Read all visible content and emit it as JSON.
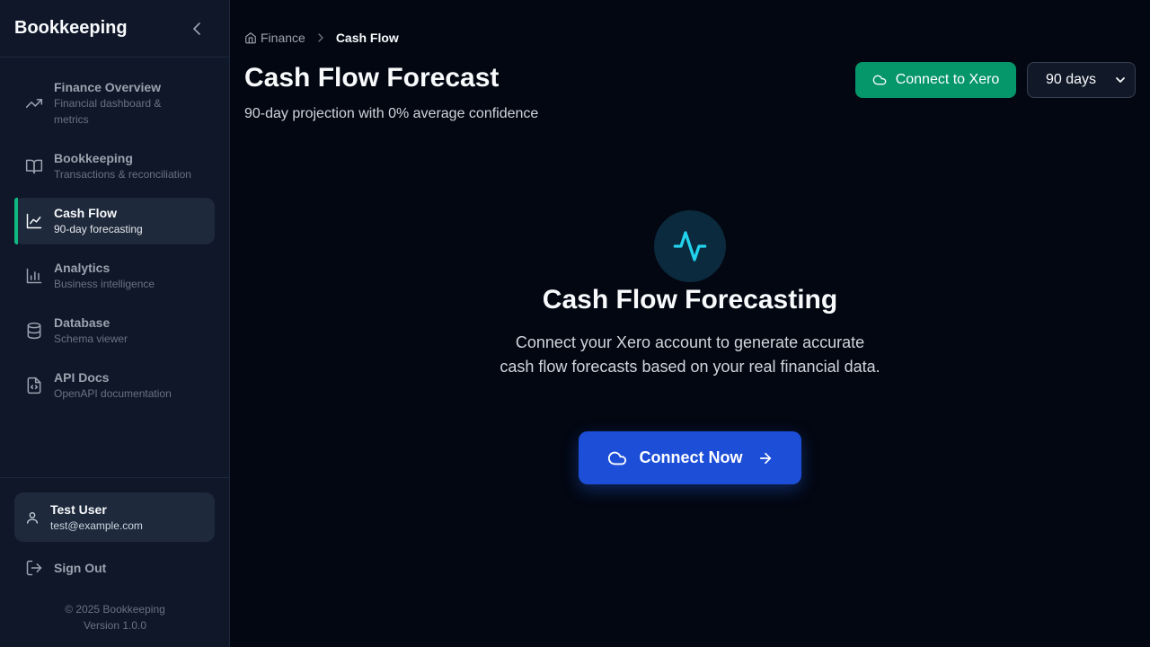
{
  "sidebar": {
    "brand": "Bookkeeping",
    "items": [
      {
        "title": "Finance Overview",
        "sub": "Financial dashboard & metrics",
        "icon": "trending-up-icon"
      },
      {
        "title": "Bookkeeping",
        "sub": "Transactions & reconciliation",
        "icon": "book-open-icon"
      },
      {
        "title": "Cash Flow",
        "sub": "90-day forecasting",
        "icon": "line-chart-icon",
        "active": true
      },
      {
        "title": "Analytics",
        "sub": "Business intelligence",
        "icon": "bar-chart-icon"
      },
      {
        "title": "Database",
        "sub": "Schema viewer",
        "icon": "database-icon"
      },
      {
        "title": "API Docs",
        "sub": "OpenAPI documentation",
        "icon": "file-code-icon"
      }
    ],
    "user": {
      "name": "Test User",
      "email": "test@example.com"
    },
    "sign_out": "Sign Out",
    "copyright": "© 2025 Bookkeeping",
    "version": "Version 1.0.0"
  },
  "breadcrumb": {
    "parent": "Finance",
    "current": "Cash Flow"
  },
  "header": {
    "title": "Cash Flow Forecast",
    "subtitle": "90-day projection with 0% average confidence",
    "connect_xero": "Connect to Xero",
    "range_selected": "90 days"
  },
  "empty_state": {
    "title": "Cash Flow Forecasting",
    "description": "Connect your Xero account to generate accurate cash flow forecasts based on your real financial data.",
    "button": "Connect Now"
  },
  "colors": {
    "background": "#030712",
    "sidebar": "#0f1729",
    "accent_green": "#059669",
    "active_bar": "#10b981",
    "primary_blue": "#1d4ed8",
    "pulse_cyan": "#22d3ee"
  }
}
